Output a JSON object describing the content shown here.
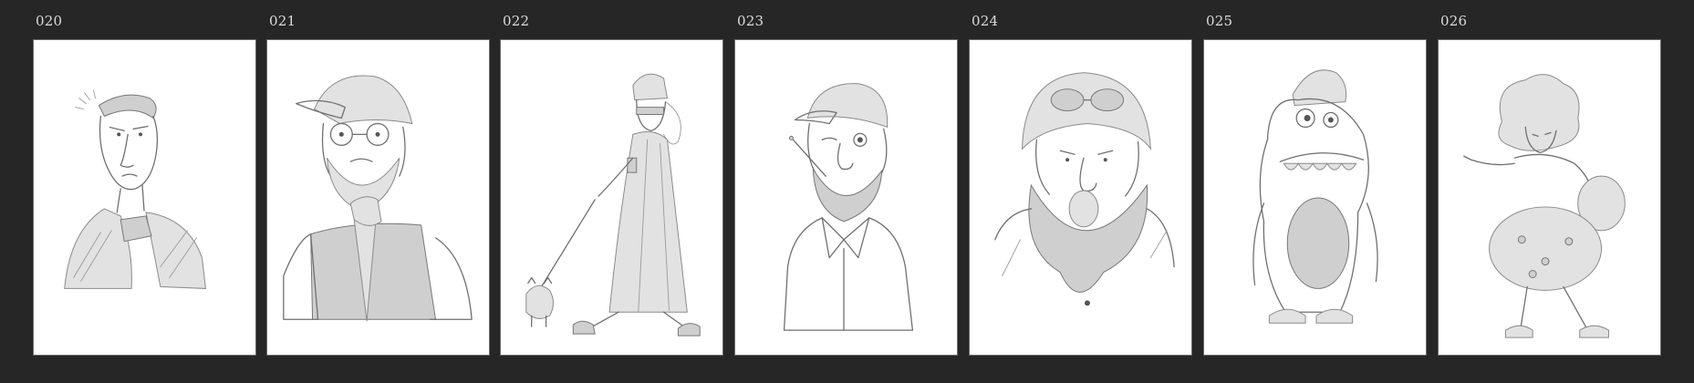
{
  "background_color": "#262626",
  "sketches": [
    {
      "label": "020",
      "subject": "roman-emperor-sketch"
    },
    {
      "label": "021",
      "subject": "bearded-man-cap-glasses-sketch"
    },
    {
      "label": "022",
      "subject": "woman-walking-dog-sketch"
    },
    {
      "label": "023",
      "subject": "winking-man-cigarette-sketch"
    },
    {
      "label": "024",
      "subject": "aviator-beard-sketch"
    },
    {
      "label": "025",
      "subject": "furry-creature-sketch"
    },
    {
      "label": "026",
      "subject": "afro-woman-sketch"
    }
  ]
}
